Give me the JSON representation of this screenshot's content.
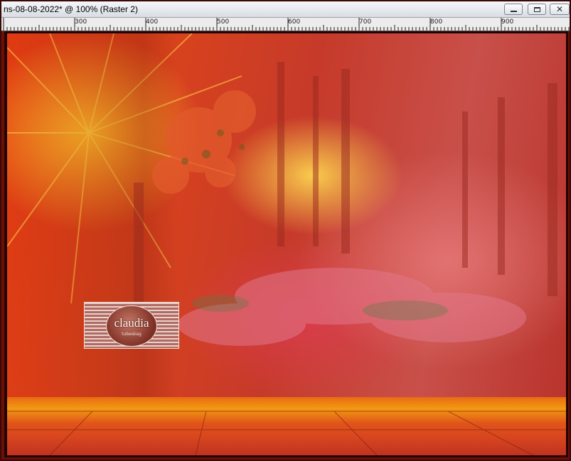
{
  "window": {
    "title": "ns-08-08-2022* @ 100% (Raster 2)",
    "buttons": {
      "minimize": "minimize",
      "maximize": "maximize",
      "close": "close"
    }
  },
  "ruler": {
    "labels": [
      "300",
      "400",
      "500",
      "600",
      "700",
      "800",
      "900"
    ]
  },
  "watermark": {
    "name": "claudia",
    "subtitle": "tubeskag"
  },
  "colors": {
    "accent_orange": "#f29a12",
    "deep_red": "#c63a2a",
    "frame": "#3a0805"
  }
}
